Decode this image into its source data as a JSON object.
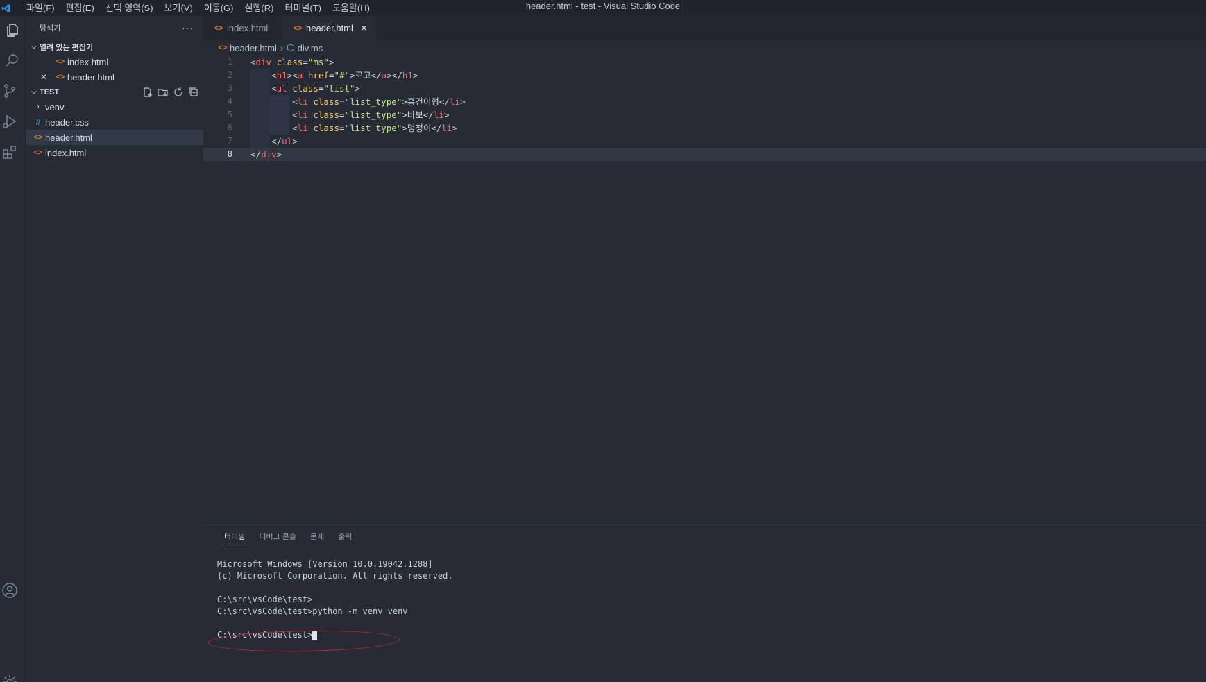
{
  "titlebar": {
    "menu": [
      "파일(F)",
      "편집(E)",
      "선택 영역(S)",
      "보기(V)",
      "이동(G)",
      "실행(R)",
      "터미널(T)",
      "도움말(H)"
    ],
    "window_title": "header.html - test - Visual Studio Code"
  },
  "activitybar": {
    "icons": [
      "explorer-icon",
      "search-icon",
      "source-control-icon",
      "run-debug-icon",
      "extensions-icon",
      "account-icon",
      "settings-icon"
    ]
  },
  "sidebar": {
    "title": "탐색기",
    "more": "···",
    "open_editors": {
      "label": "열려 있는 편집기",
      "files": [
        {
          "name": "index.html",
          "icon": "<>"
        },
        {
          "name": "header.html",
          "icon": "<>",
          "close": "✕"
        }
      ]
    },
    "workspace": {
      "label": "TEST",
      "items": [
        {
          "name": "venv",
          "type": "folder"
        },
        {
          "name": "header.css",
          "type": "css",
          "icon": "#"
        },
        {
          "name": "header.html",
          "type": "html",
          "icon": "<>",
          "selected": true
        },
        {
          "name": "index.html",
          "type": "html",
          "icon": "<>"
        }
      ]
    }
  },
  "editor": {
    "tabs": [
      {
        "label": "index.html",
        "icon": "<>",
        "active": false
      },
      {
        "label": "header.html",
        "icon": "<>",
        "active": true,
        "close": "✕"
      }
    ],
    "breadcrumbs": {
      "file": "header.html",
      "symbol": "div.ms"
    },
    "line_numbers": [
      "1",
      "2",
      "3",
      "4",
      "5",
      "6",
      "7",
      "8"
    ],
    "current_line": 8,
    "lines": [
      "<div class=\"ms\">",
      "    <h1><a href=\"#\">로고</a></h1>",
      "    <ul class=\"list\">",
      "        <li class=\"list_type\">홍건이형</li>",
      "        <li class=\"list_type\">바보</li>",
      "        <li class=\"list_type\">멍청이</li>",
      "    </ul>",
      "</div>"
    ]
  },
  "panel": {
    "tabs": [
      "터미널",
      "디버그 콘솔",
      "문제",
      "출력"
    ],
    "active_tab": "터미널",
    "terminal_lines": [
      "Microsoft Windows [Version 10.0.19042.1288]",
      "(c) Microsoft Corporation. All rights reserved.",
      "",
      "C:\\src\\vsCode\\test>",
      "C:\\src\\vsCode\\test>python -m venv venv",
      "",
      "C:\\src\\vsCode\\test>"
    ]
  },
  "colors": {
    "background": "#262b36",
    "titlebar": "#1f232c",
    "html_icon": "#e37933",
    "css_icon": "#519aba",
    "tag": "#ff6b6b",
    "attribute": "#ffcb6b",
    "string": "#c3e88d",
    "annotation": "#c0262d"
  }
}
